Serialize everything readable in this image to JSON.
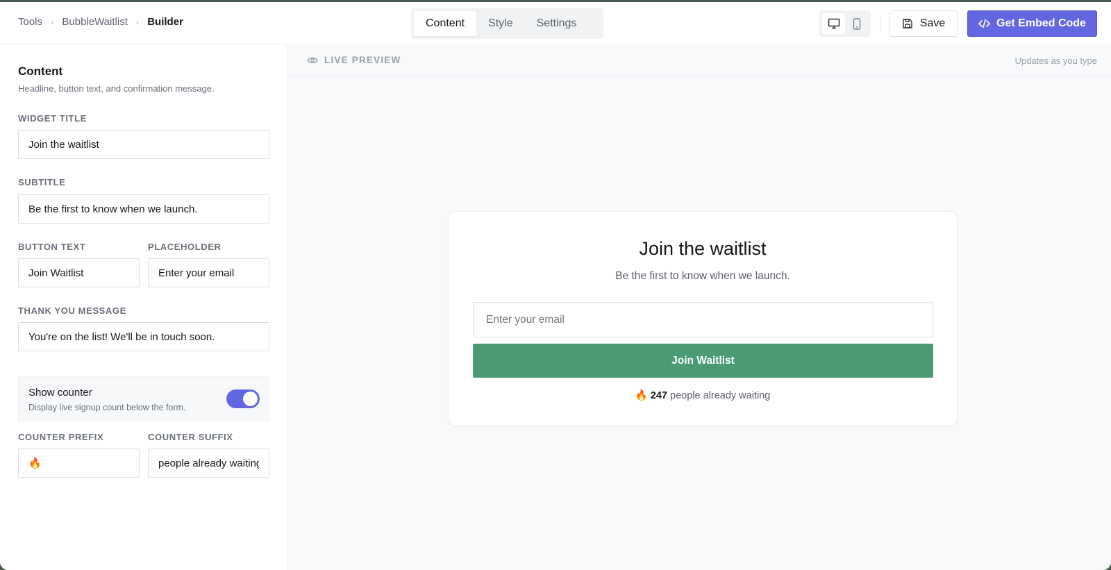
{
  "breadcrumb": [
    "Tools",
    "BubbleWaitlist",
    "Builder"
  ],
  "tabs": [
    {
      "label": "Content",
      "active": true
    },
    {
      "label": "Style",
      "active": false
    },
    {
      "label": "Settings",
      "active": false
    }
  ],
  "devices": [
    {
      "icon": "desktop-icon",
      "active": true
    },
    {
      "icon": "mobile-icon",
      "active": false
    }
  ],
  "toolbar": {
    "save_label": "Save",
    "embed_label": "Get Embed Code"
  },
  "colors": {
    "accent": "#6366e1",
    "button": "#4a9a74"
  },
  "panel": {
    "title": "Content",
    "description": "Headline, button text, and confirmation message.",
    "widget_title": {
      "label": "WIDGET TITLE",
      "value": "Join the waitlist"
    },
    "subtitle": {
      "label": "SUBTITLE",
      "value": "Be the first to know when we launch."
    },
    "button_text": {
      "label": "BUTTON TEXT",
      "value": "Join Waitlist"
    },
    "placeholder": {
      "label": "PLACEHOLDER",
      "value": "Enter your email"
    },
    "thank_you": {
      "label": "THANK YOU MESSAGE",
      "value": "You're on the list! We'll be in touch soon."
    },
    "show_counter": {
      "label": "Show counter",
      "description": "Display live signup count below the form.",
      "enabled": true
    },
    "counter_prefix": {
      "label": "COUNTER PREFIX",
      "value": "🔥"
    },
    "counter_suffix": {
      "label": "COUNTER SUFFIX",
      "value": "people already waiting"
    }
  },
  "preview": {
    "header_label": "LIVE PREVIEW",
    "header_note": "Updates as you type",
    "title": "Join the waitlist",
    "subtitle": "Be the first to know when we launch.",
    "email_placeholder": "Enter your email",
    "button_label": "Join Waitlist",
    "counter_prefix": "🔥",
    "counter_value": "247",
    "counter_suffix": "people already waiting"
  }
}
